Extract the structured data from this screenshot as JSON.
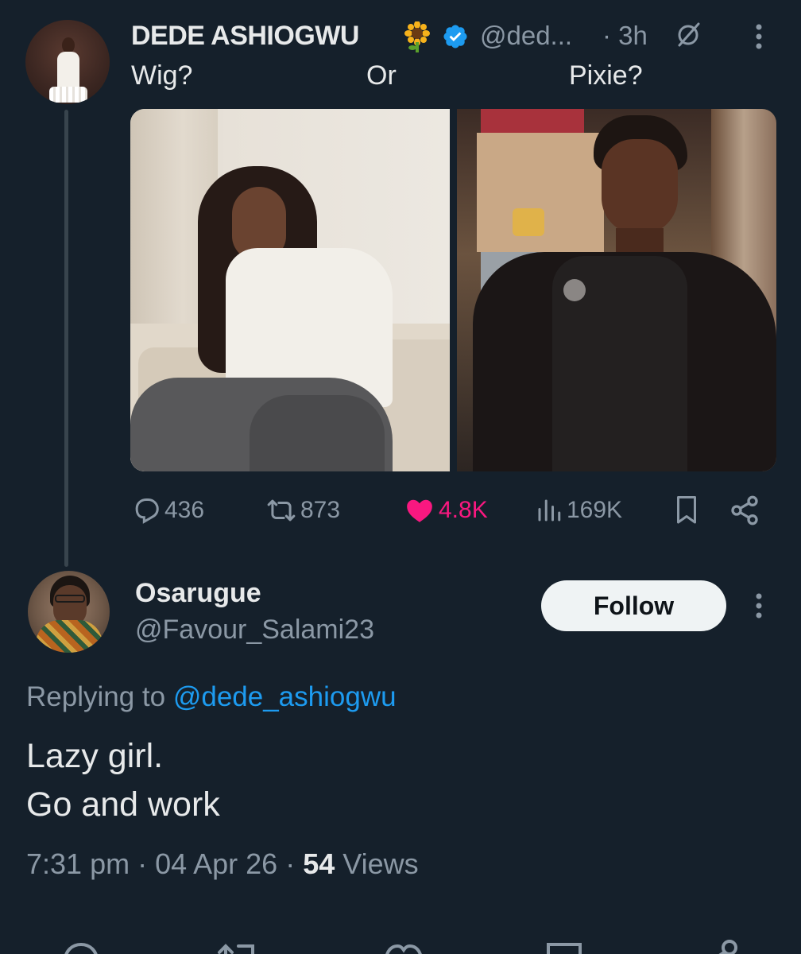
{
  "tweet": {
    "author_name": "DEDE ASHIOGWU",
    "author_emoji": "🌻",
    "handle": "@ded...",
    "time": "· 3h",
    "text_parts": [
      "Wig?",
      "Or",
      "Pixie?"
    ],
    "stats": {
      "replies": "436",
      "reposts": "873",
      "likes": "4.8K",
      "views": "169K"
    }
  },
  "reply": {
    "author_name": "Osarugue",
    "handle": "@Favour_Salami23",
    "follow_label": "Follow",
    "replying_prefix": "Replying to ",
    "replying_to": "@dede_ashiogwu",
    "lines": [
      "Lazy girl.",
      "Go and work"
    ],
    "time": "7:31 pm · 04 Apr 26 · ",
    "views_count": "54",
    "views_label": " Views"
  },
  "colors": {
    "background": "#15202b",
    "text": "#e7e9ea",
    "muted": "#8b98a5",
    "accent": "#1d9bf0",
    "like": "#f91880"
  },
  "icons": [
    "verified-badge-icon",
    "grok-icon",
    "more-icon",
    "reply-icon",
    "repost-icon",
    "heart-icon",
    "views-icon",
    "bookmark-icon",
    "share-icon"
  ]
}
